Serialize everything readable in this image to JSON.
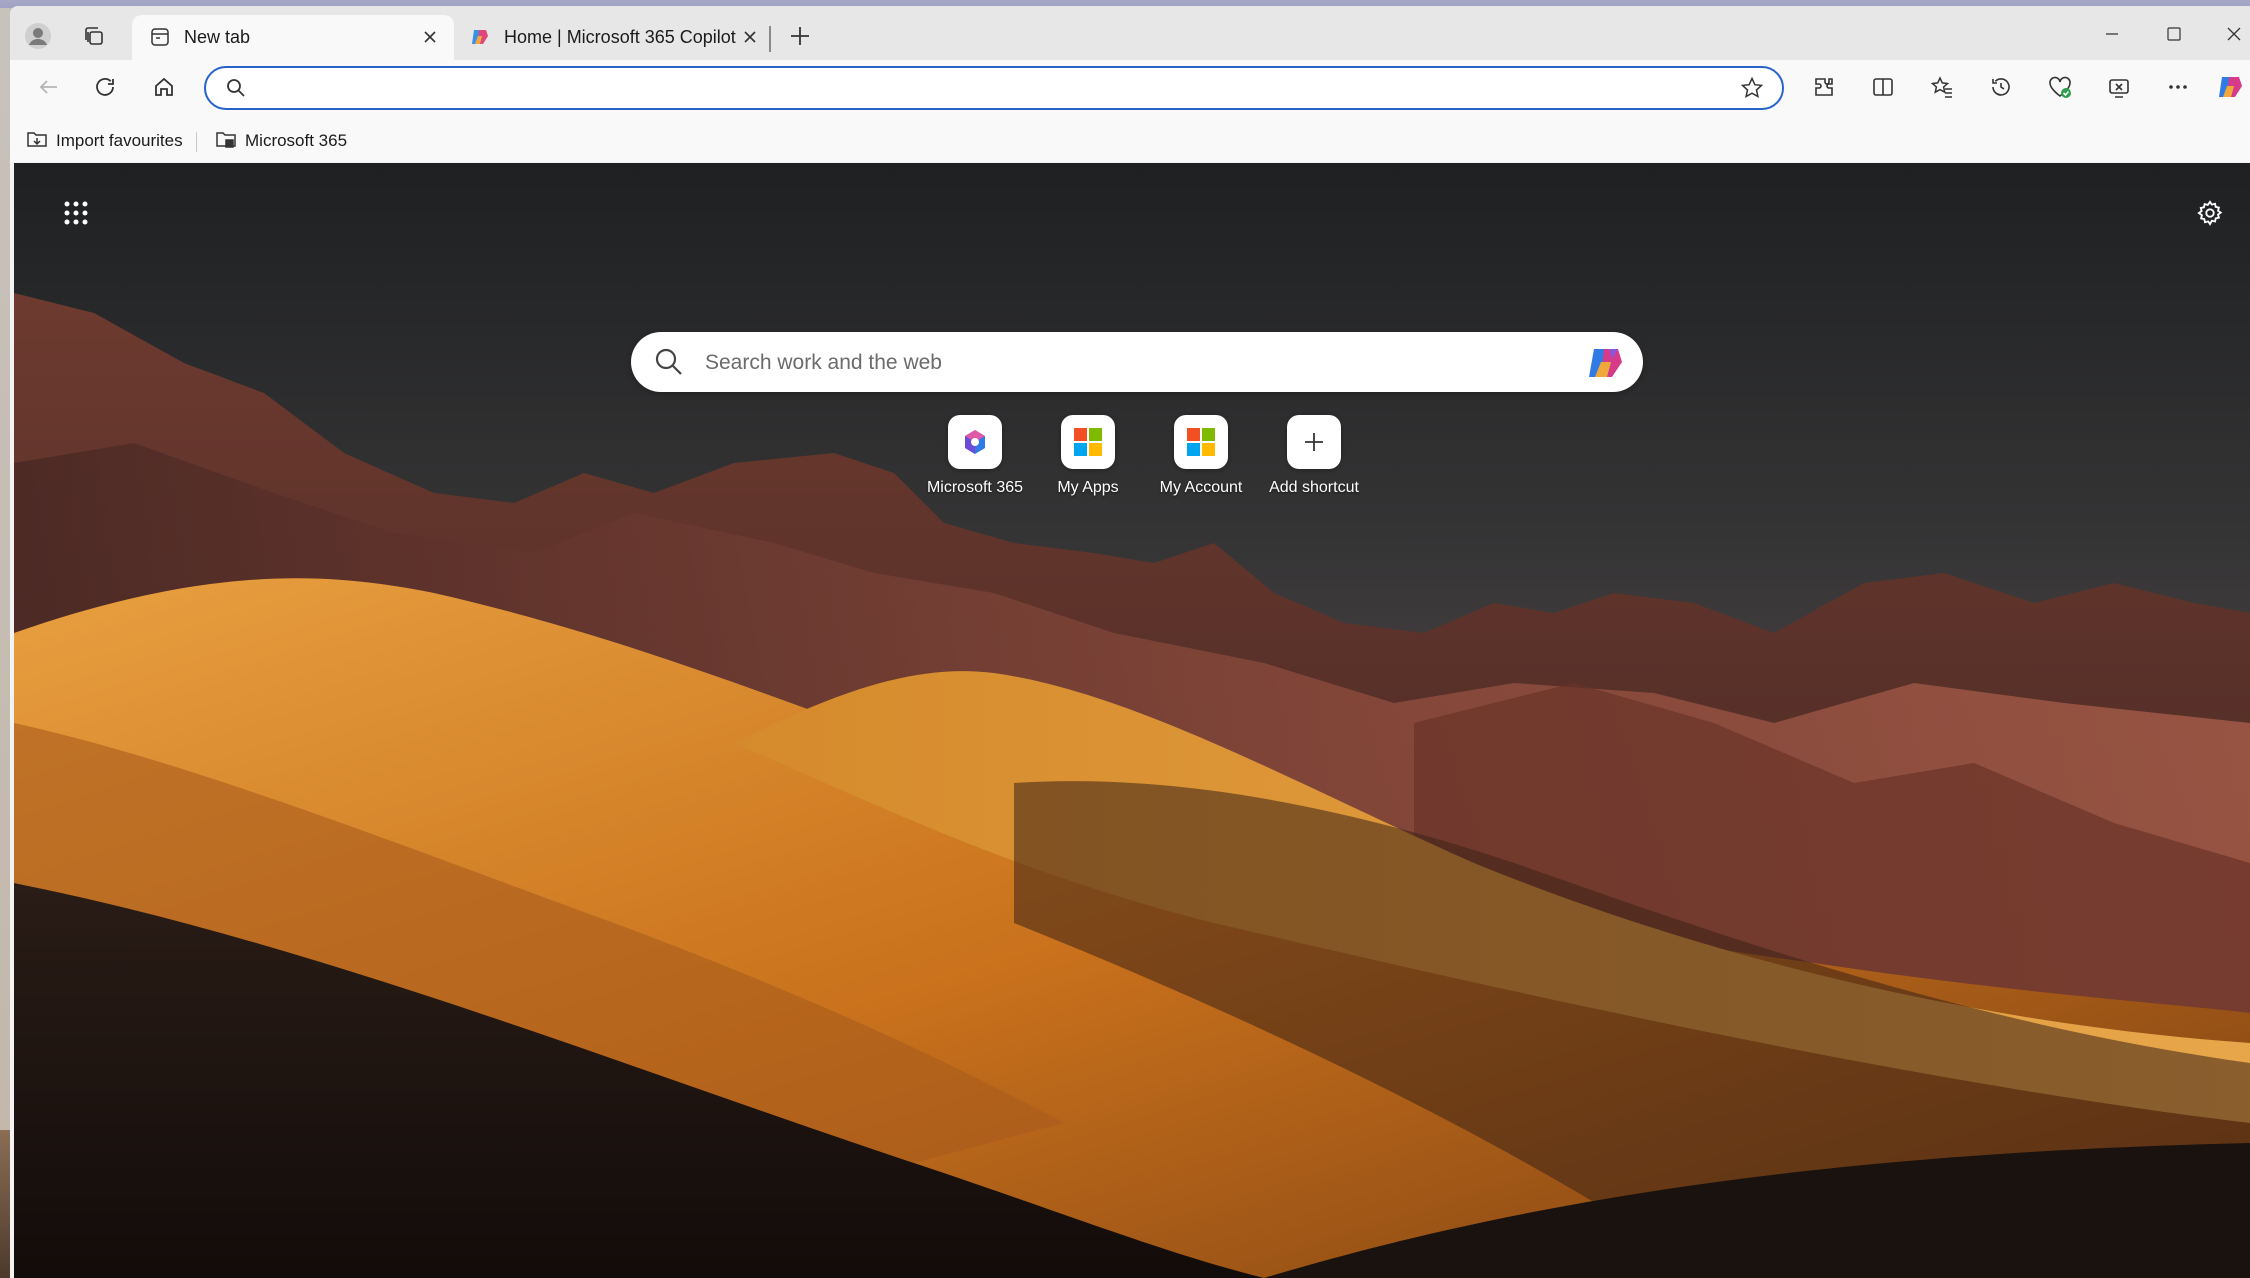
{
  "browser": {
    "tabs": [
      {
        "label": "New tab",
        "active": true,
        "icon": "new-tab-icon"
      },
      {
        "label": "Home | Microsoft 365 Copilot",
        "active": false,
        "icon": "copilot-icon"
      }
    ],
    "address_bar": {
      "value": "",
      "placeholder": ""
    },
    "favourites": [
      {
        "label": "Import favourites",
        "icon": "import-folder-icon"
      },
      {
        "label": "Microsoft 365",
        "icon": "folder-icon"
      }
    ],
    "toolbar_icons": [
      "back-icon",
      "refresh-icon",
      "home-icon",
      "favorite-star-icon",
      "extensions-icon",
      "split-screen-icon",
      "favorites-icon",
      "history-icon",
      "browser-essentials-icon",
      "screenshot-icon",
      "more-icon",
      "copilot-icon"
    ],
    "accent": "#2563c9"
  },
  "new_tab": {
    "search": {
      "placeholder": "Search work and the web"
    },
    "shortcuts": [
      {
        "label": "Microsoft 365",
        "icon": "microsoft-365-icon"
      },
      {
        "label": "My Apps",
        "icon": "microsoft-logo-icon"
      },
      {
        "label": "My Account",
        "icon": "microsoft-logo-icon"
      },
      {
        "label": "Add shortcut",
        "icon": "plus-icon"
      }
    ],
    "background": "desert dunes and mountains"
  }
}
